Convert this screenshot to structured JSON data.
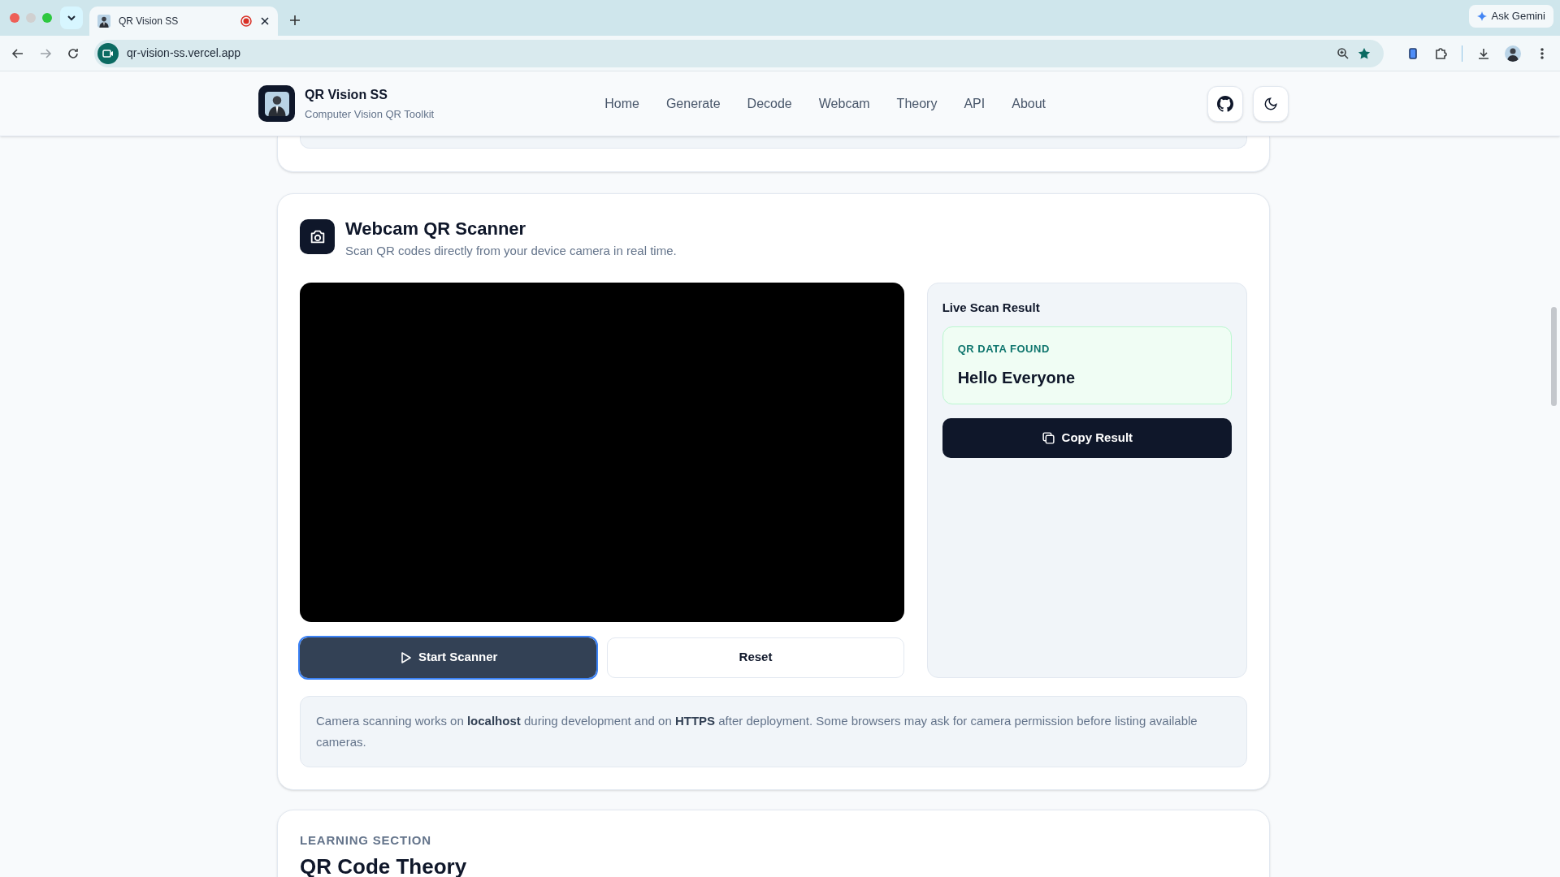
{
  "browser": {
    "tab": {
      "title": "QR Vision SS",
      "recording": true
    },
    "url": "qr-vision-ss.vercel.app",
    "ask_button": "Ask Gemini"
  },
  "header": {
    "brand": "QR Vision SS",
    "tagline": "Computer Vision QR Toolkit",
    "nav": [
      "Home",
      "Generate",
      "Decode",
      "Webcam",
      "Theory",
      "API",
      "About"
    ]
  },
  "webcam_section": {
    "title": "Webcam QR Scanner",
    "subtitle": "Scan QR codes directly from your device camera in real time.",
    "buttons": [
      {
        "label": "Start Scanner",
        "kind": "primary",
        "focused": true
      },
      {
        "label": "Reset",
        "kind": "secondary",
        "focused": false
      }
    ],
    "result_panel": {
      "title": "Live Scan Result",
      "status": "QR DATA FOUND",
      "value": "Hello Everyone",
      "copy_button": "Copy Result"
    },
    "note": "Camera scanning works on **localhost** during development and on **HTTPS** after deployment. Some browsers may ask for camera permission before listing available cameras."
  },
  "learning_section": {
    "eyebrow": "LEARNING SECTION",
    "title": "QR Code Theory"
  }
}
